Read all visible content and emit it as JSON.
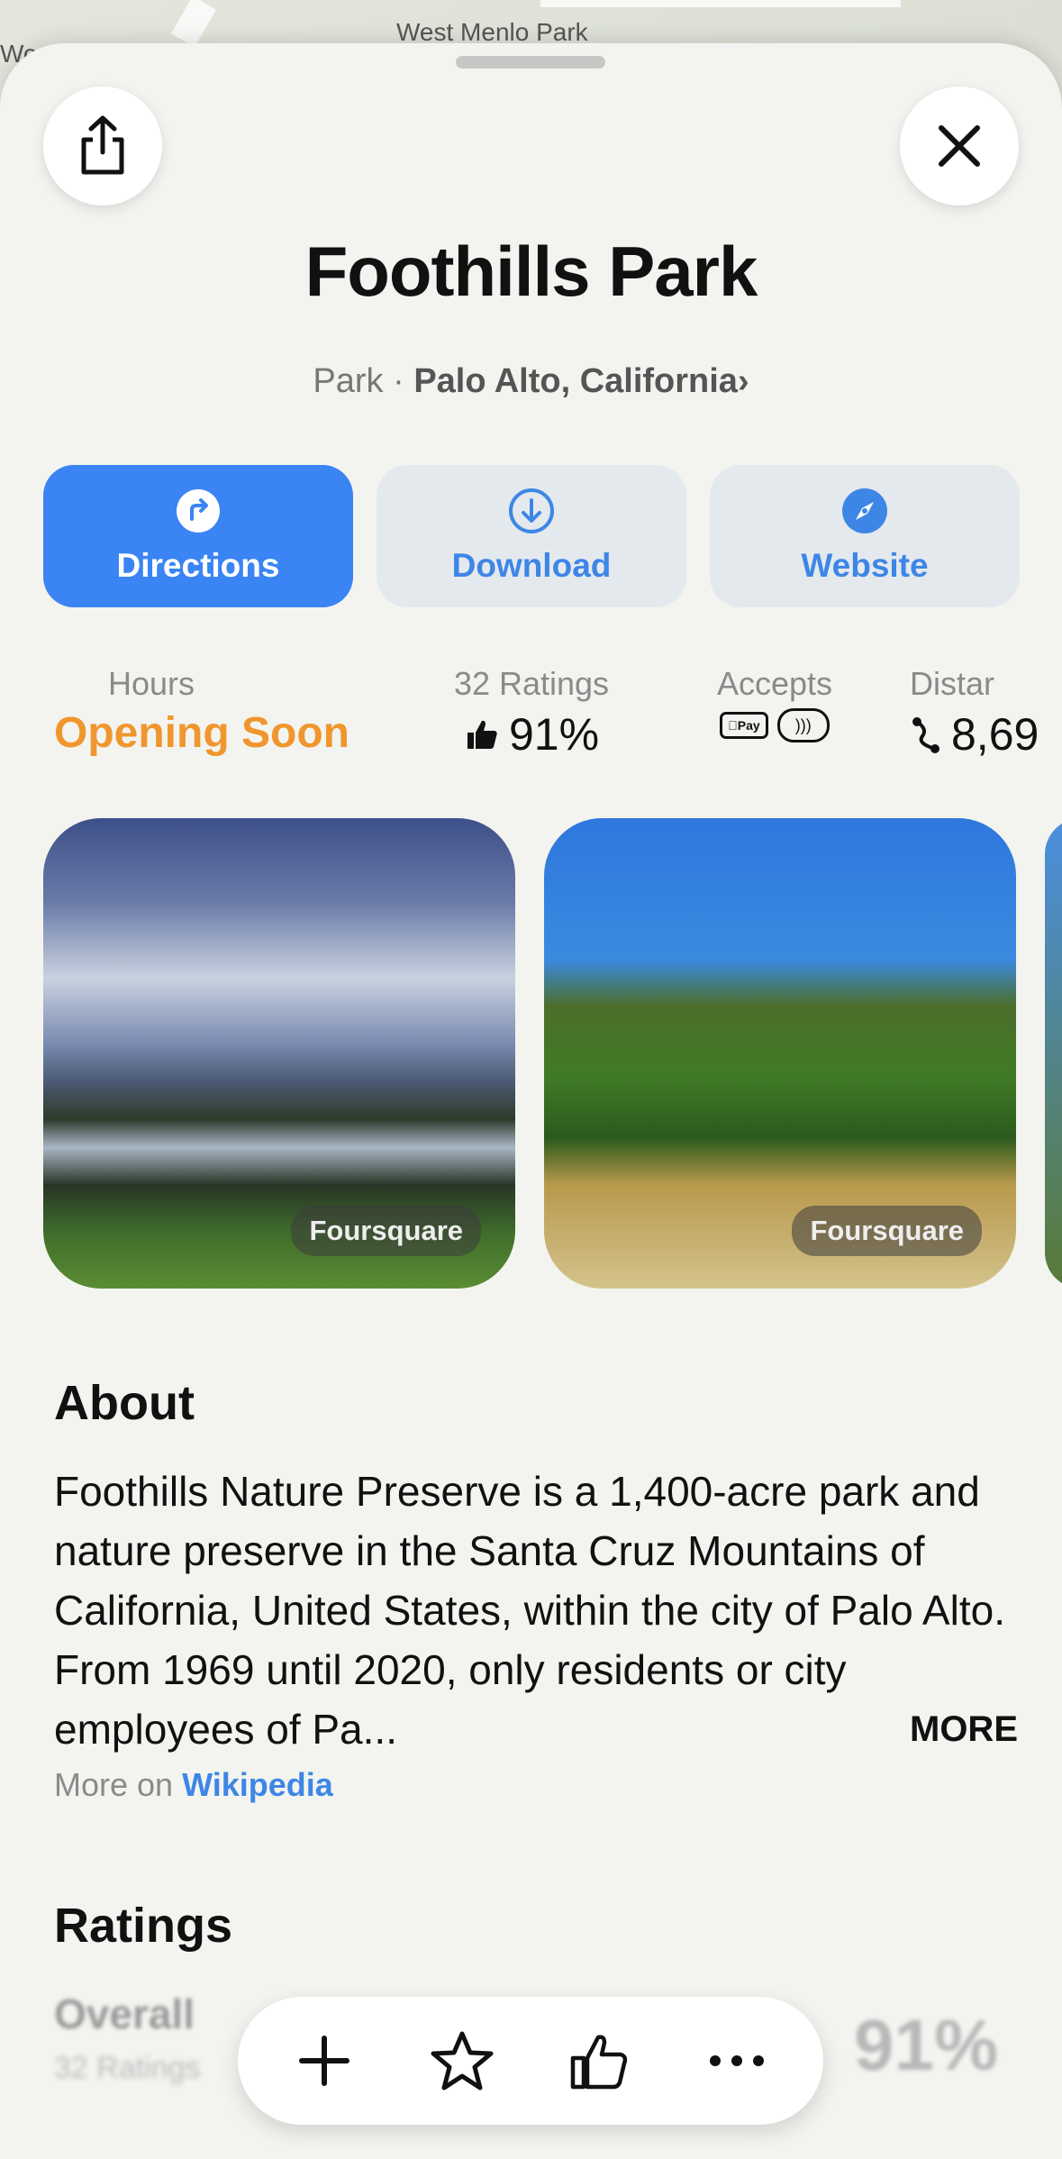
{
  "map": {
    "label_top": "West Menlo Park",
    "label_left": "Woo"
  },
  "place": {
    "title": "Foothills Park",
    "category": "Park",
    "separator": "·",
    "location": "Palo Alto, California",
    "chevron": "›"
  },
  "actions": [
    {
      "label": "Directions",
      "icon": "directions-icon"
    },
    {
      "label": "Download",
      "icon": "download-icon"
    },
    {
      "label": "Website",
      "icon": "compass-icon"
    }
  ],
  "info": {
    "hours": {
      "label": "Hours",
      "value": "Opening Soon"
    },
    "ratings": {
      "label": "32 Ratings",
      "value": "91%"
    },
    "accepts": {
      "label": "Accepts",
      "apple_pay": "Pay"
    },
    "distance": {
      "label": "Distar",
      "value": "8,69"
    }
  },
  "photos": [
    {
      "credit": "Foursquare"
    },
    {
      "credit": "Foursquare"
    }
  ],
  "about": {
    "heading": "About",
    "text": "Foothills Nature Preserve is a 1,400-acre park and nature preserve in the Santa Cruz Mountains of California, United States, within the city of Palo Alto. From 1969 until 2020, only residents or city employees of Pa...",
    "more": "MORE",
    "source_prefix": "More on",
    "source_link": "Wikipedia"
  },
  "ratings": {
    "heading": "Ratings",
    "overall_label": "Overall",
    "overall_sub": "32 Ratings",
    "overall_value": "91%"
  },
  "toolbar": [
    "add-icon",
    "star-icon",
    "thumbs-up-icon",
    "more-icon"
  ],
  "colors": {
    "accent": "#3a84f4",
    "hours": "#f0962e",
    "link": "#3e86e6"
  }
}
